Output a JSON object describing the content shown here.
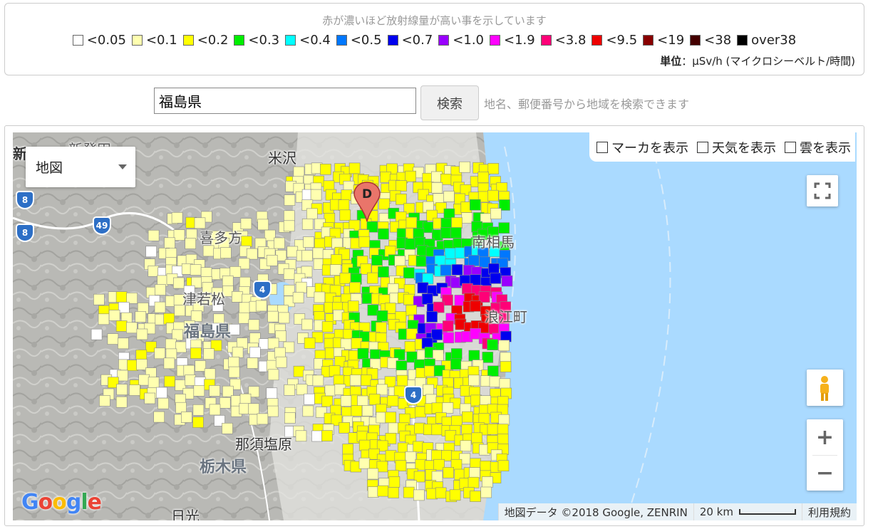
{
  "legend": {
    "caption": "赤が濃いほど放射線量が高い事を示しています",
    "items": [
      {
        "label": "<0.05",
        "color": "#ffffff"
      },
      {
        "label": "<0.1",
        "color": "#ffffb0"
      },
      {
        "label": "<0.2",
        "color": "#ffff00"
      },
      {
        "label": "<0.3",
        "color": "#00ee00"
      },
      {
        "label": "<0.4",
        "color": "#00ffff"
      },
      {
        "label": "<0.5",
        "color": "#0077ff"
      },
      {
        "label": "<0.7",
        "color": "#0000ee"
      },
      {
        "label": "<1.0",
        "color": "#9900ff"
      },
      {
        "label": "<1.9",
        "color": "#ff00ff"
      },
      {
        "label": "<3.8",
        "color": "#ff0077"
      },
      {
        "label": "<9.5",
        "color": "#ee0000"
      },
      {
        "label": "<19",
        "color": "#880000"
      },
      {
        "label": "<38",
        "color": "#440000"
      },
      {
        "label": "over38",
        "color": "#000000"
      }
    ],
    "unit_label": "単位",
    "unit_value": "：μSv/h (マイクロシーベルト/時間)"
  },
  "search": {
    "value": "福島県",
    "button_label": "検索",
    "hint": "地名、郵便番号から地域を検索できます"
  },
  "map": {
    "type_selector": "地図",
    "toggles": [
      "マーカを表示",
      "天気を表示",
      "雲を表示"
    ],
    "marker_letter": "D",
    "zoom_in": "+",
    "zoom_out": "−",
    "attribution": "地図データ ©2018 Google, ZENRIN",
    "scale_label": "20 km",
    "terms": "利用規約",
    "logo": "Google",
    "places": {
      "yonezawa": "米沢",
      "shinhatsuda": "新発田",
      "kitakata": "喜多方",
      "aizu": "津若松",
      "nasushiobara": "那須塩原",
      "nikko": "日光",
      "minamisoma": "南相馬",
      "namie": "浪江町"
    },
    "prefectures": {
      "fukushima": "福島県",
      "tochigi": "栃木県",
      "niigata": "新"
    },
    "shields": [
      "8",
      "8",
      "49",
      "4",
      "4"
    ]
  }
}
